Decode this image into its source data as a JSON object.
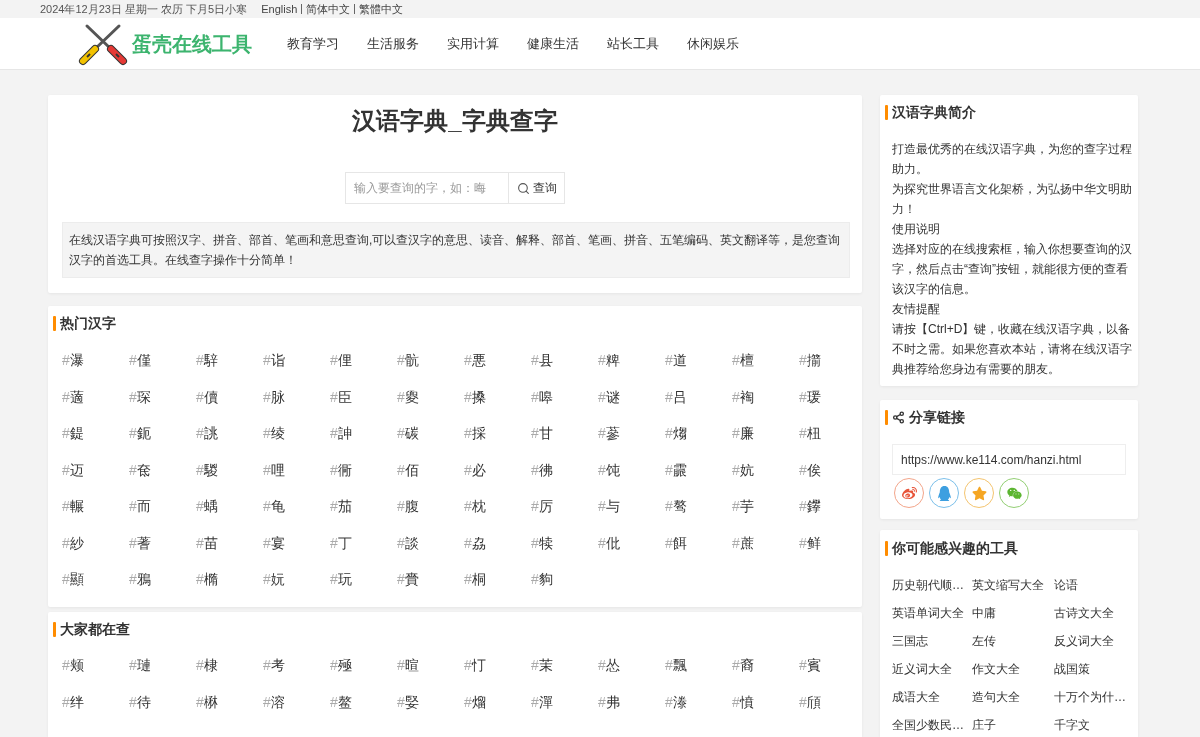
{
  "top_bar": {
    "date": "2024年12月23日 星期一 农历 下月5日小寒",
    "languages": [
      "English",
      "简体中文",
      "繁體中文"
    ]
  },
  "header": {
    "logo_text": "蛋壳在线工具",
    "nav": [
      "教育学习",
      "生活服务",
      "实用计算",
      "健康生活",
      "站长工具",
      "休闲娱乐"
    ]
  },
  "dictionary_card": {
    "title": "汉语字典_字典查字",
    "search": {
      "placeholder": "输入要查询的字，如：晦",
      "button": "查询"
    },
    "description": "在线汉语字典可按照汉字、拼音、部首、笔画和意思查询,可以查汉字的意思、读音、解释、部首、笔画、拼音、五笔编码、英文翻译等，是您查询汉字的首选工具。在线查字操作十分简单！"
  },
  "hot_characters": {
    "heading": "热门汉字",
    "items": [
      "#瀑",
      "#僅",
      "#騂",
      "#诣",
      "#俚",
      "#骯",
      "#悪",
      "#县",
      "#粺",
      "#道",
      "#檀",
      "#擶",
      "#藡",
      "#琛",
      "#儥",
      "#脉",
      "#臣",
      "#夓",
      "#搡",
      "#嗥",
      "#谜",
      "#吕",
      "#裪",
      "#瑗",
      "#鍉",
      "#鈪",
      "#誂",
      "#绫",
      "#訷",
      "#碳",
      "#採",
      "#甘",
      "#蔘",
      "#煼",
      "#廉",
      "#杻",
      "#迈",
      "#奃",
      "#騣",
      "#哩",
      "#衕",
      "#佰",
      "#必",
      "#彿",
      "#饨",
      "#霢",
      "#妔",
      "#俟",
      "#輾",
      "#而",
      "#蝺",
      "#龟",
      "#茄",
      "#腹",
      "#枕",
      "#厉",
      "#与",
      "#骜",
      "#芋",
      "#鑻",
      "#紗",
      "#蓍",
      "#苗",
      "#宴",
      "#丁",
      "#談",
      "#劦",
      "#犊",
      "#仳",
      "#餌",
      "#蔗",
      "#鲜",
      "#顯",
      "#鴉",
      "#橢",
      "#妧",
      "#玩",
      "#賫",
      "#桐",
      "#豿"
    ]
  },
  "popular_searches": {
    "heading": "大家都在查",
    "items": [
      "#颊",
      "#璉",
      "#棣",
      "#考",
      "#殛",
      "#暄",
      "#忊",
      "#茉",
      "#怂",
      "#飄",
      "#裔",
      "#賓",
      "#绊",
      "#待",
      "#楙",
      "#溶",
      "#鳌",
      "#婜",
      "#熘",
      "#潬",
      "#弗",
      "#漛",
      "#憤",
      "#頎"
    ]
  },
  "intro_card": {
    "heading": "汉语字典简介",
    "paragraphs": [
      "打造最优秀的在线汉语字典，为您的查字过程助力。",
      "为探究世界语言文化架桥，为弘扬中华文明助力！",
      "使用说明",
      "选择对应的在线搜索框，输入你想要查询的汉字，然后点击“查询”按钮，就能很方便的查看该汉字的信息。",
      "友情提醒",
      "请按【Ctrl+D】键，收藏在线汉语字典，以备不时之需。如果您喜欢本站，请将在线汉语字典推荐给您身边有需要的朋友。"
    ]
  },
  "share_card": {
    "heading": "分享链接",
    "url": "https://www.ke114.com/hanzi.html"
  },
  "tools_card": {
    "heading": "你可能感兴趣的工具",
    "items": [
      "历史朝代顺…",
      "英文缩写大全",
      "论语",
      "英语单词大全",
      "中庸",
      "古诗文大全",
      "三国志",
      "左传",
      "反义词大全",
      "近义词大全",
      "作文大全",
      "战国策",
      "成语大全",
      "造句大全",
      "十万个为什…",
      "全国少数民…",
      "庄子",
      "千字文"
    ]
  }
}
